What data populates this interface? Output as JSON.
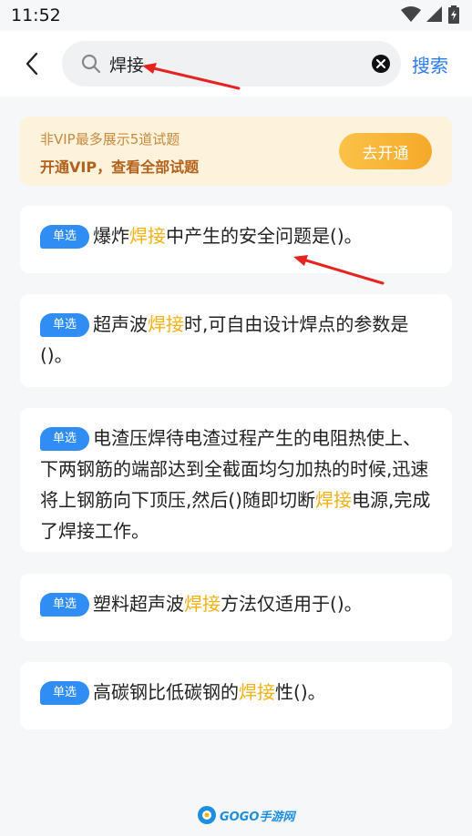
{
  "status_bar": {
    "time": "11:52"
  },
  "top_bar": {
    "search_value": "焊接",
    "search_button": "搜索"
  },
  "vip_banner": {
    "notice": "非VIP最多展示5道试题",
    "promo": "开通VIP，查看全部试题",
    "button": "去开通"
  },
  "questions": [
    {
      "type": "单选",
      "before": "爆炸",
      "keyword": "焊接",
      "after": "中产生的安全问题是()。"
    },
    {
      "type": "单选",
      "before": "超声波",
      "keyword": "焊接",
      "after": "时,可自由设计焊点的参数是()。"
    },
    {
      "type": "单选",
      "before": "电渣压焊待电渣过程产生的电阻热使上、下两钢筋的端部达到全截面均匀加热的时候,迅速将上钢筋向下顶压,然后()随即切断",
      "keyword": "焊接",
      "after": "电源,完成了焊接工作。"
    },
    {
      "type": "单选",
      "before": "塑料超声波",
      "keyword": "焊接",
      "after": "方法仅适用于()。"
    },
    {
      "type": "单选",
      "before": "高碳钢比低碳钢的",
      "keyword": "焊接",
      "after": "性()。"
    }
  ],
  "watermark": {
    "logo_text": "GOGO手游网"
  },
  "colors": {
    "accent_blue": "#2a7cf0",
    "keyword_highlight": "#f3b113",
    "vip_button": "#f6a92a",
    "annotation_arrow": "#e5231f"
  },
  "icons": [
    "back-arrow-icon",
    "search-icon",
    "clear-icon",
    "wifi-icon",
    "signal-icon",
    "battery-icon"
  ]
}
